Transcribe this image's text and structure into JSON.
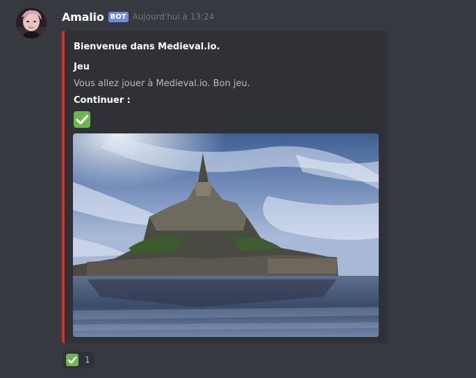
{
  "author": {
    "username": "Amalio",
    "badge": "BOT",
    "timestamp": "Aujourd'hui à 13:24",
    "badge_color": "#7289da"
  },
  "embed": {
    "accent_color": "#e1291f",
    "title": "Bienvenue dans Medieval.io.",
    "fields": [
      {
        "name": "Jeu",
        "value": "Vous allez jouer à Medieval.io. Bon jeu."
      },
      {
        "name": "Continuer :",
        "value_icon": "white-check-mark-icon"
      }
    ],
    "image": {
      "alt": "Mont-Saint-Michel"
    }
  },
  "reactions": [
    {
      "emoji": "white-check-mark-icon",
      "count": "1"
    }
  ]
}
